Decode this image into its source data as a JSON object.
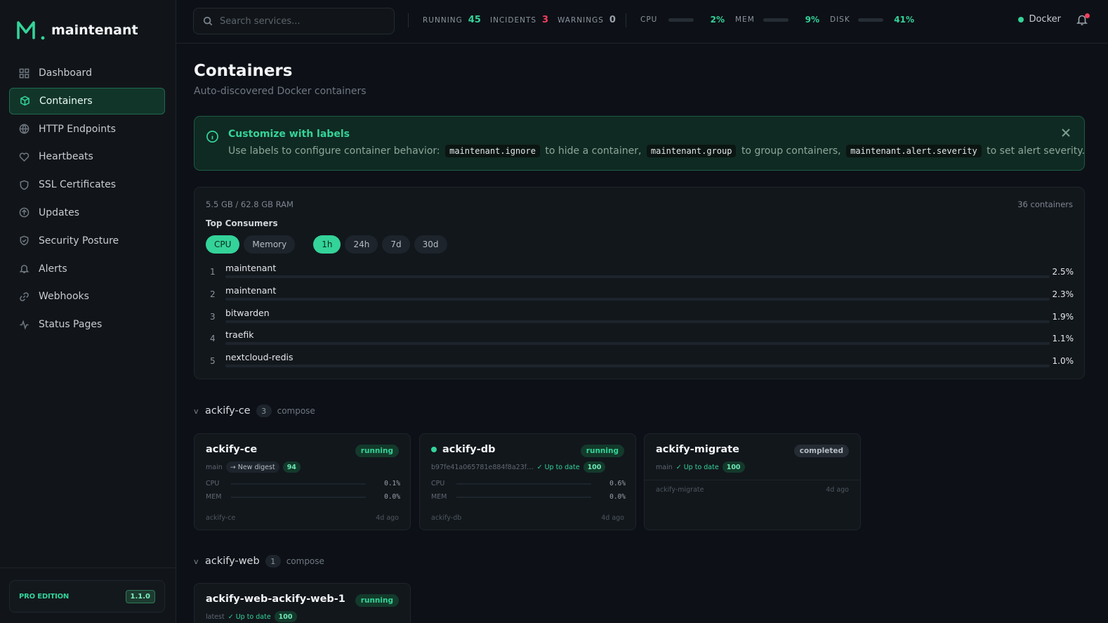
{
  "app": {
    "name": "maintenant"
  },
  "sidebar": {
    "items": [
      {
        "label": "Dashboard",
        "icon": "dashboard-icon"
      },
      {
        "label": "Containers",
        "icon": "box-icon"
      },
      {
        "label": "HTTP Endpoints",
        "icon": "globe-icon"
      },
      {
        "label": "Heartbeats",
        "icon": "heart-icon"
      },
      {
        "label": "SSL Certificates",
        "icon": "shield-icon"
      },
      {
        "label": "Updates",
        "icon": "arrow-up-circle-icon"
      },
      {
        "label": "Security Posture",
        "icon": "shield-check-icon"
      },
      {
        "label": "Alerts",
        "icon": "bell-icon"
      },
      {
        "label": "Webhooks",
        "icon": "link-icon"
      },
      {
        "label": "Status Pages",
        "icon": "activity-icon"
      }
    ],
    "active_index": 1,
    "edition": {
      "label": "PRO EDITION",
      "version": "1.1.0"
    }
  },
  "topbar": {
    "search_placeholder": "Search services...",
    "running": {
      "label": "RUNNING",
      "value": "45"
    },
    "incidents": {
      "label": "INCIDENTS",
      "value": "3"
    },
    "warnings": {
      "label": "WARNINGS",
      "value": "0"
    },
    "cpu": {
      "label": "CPU",
      "value": "2%",
      "fraction": 0.02
    },
    "mem": {
      "label": "MEM",
      "value": "9%",
      "fraction": 0.09
    },
    "disk": {
      "label": "DISK",
      "value": "41%",
      "fraction": 0.41
    },
    "runtime": "Docker"
  },
  "page": {
    "title": "Containers",
    "subtitle": "Auto-discovered Docker containers"
  },
  "banner": {
    "title": "Customize with labels",
    "text1": "Use labels to configure container behavior:",
    "code1": "maintenant.ignore",
    "text2": "to hide a container,",
    "code2": "maintenant.group",
    "text3": "to group containers,",
    "code3": "maintenant.alert.severity",
    "text4": "to set alert severity."
  },
  "consumers": {
    "ram": "5.5 GB / 62.8 GB RAM",
    "count": "36 containers",
    "title": "Top Consumers",
    "metric_tabs": [
      "CPU",
      "Memory"
    ],
    "range_tabs": [
      "1h",
      "24h",
      "7d",
      "30d"
    ],
    "active_metric": "CPU",
    "active_range": "1h",
    "rows": [
      {
        "rank": "1",
        "name": "maintenant",
        "pct": "2.5%",
        "value": 2.5
      },
      {
        "rank": "2",
        "name": "maintenant",
        "pct": "2.3%",
        "value": 2.3
      },
      {
        "rank": "3",
        "name": "bitwarden",
        "pct": "1.9%",
        "value": 1.9
      },
      {
        "rank": "4",
        "name": "traefik",
        "pct": "1.1%",
        "value": 1.1
      },
      {
        "rank": "5",
        "name": "nextcloud-redis",
        "pct": "1.0%",
        "value": 1.0
      }
    ]
  },
  "groups": [
    {
      "name": "ackify-ce",
      "count": "3",
      "type": "compose",
      "cards": [
        {
          "name": "ackify-ce",
          "status": "running",
          "tag": "main",
          "update": "New digest",
          "score": "94",
          "cpu_label": "CPU",
          "cpu": "0.1%",
          "mem_label": "MEM",
          "mem": "0.0%",
          "service": "ackify-ce",
          "ago": "4d ago"
        },
        {
          "name": "ackify-db",
          "status": "running",
          "tag": "b97fe41a065781e884f8a23f…",
          "update": "Up to date",
          "score": "100",
          "cpu_label": "CPU",
          "cpu": "0.6%",
          "mem_label": "MEM",
          "mem": "0.0%",
          "service": "ackify-db",
          "ago": "4d ago"
        },
        {
          "name": "ackify-migrate",
          "status": "completed",
          "tag": "main",
          "update": "Up to date",
          "score": "100",
          "service": "ackify-migrate",
          "ago": "4d ago"
        }
      ]
    },
    {
      "name": "ackify-web",
      "count": "1",
      "type": "compose",
      "cards": [
        {
          "name": "ackify-web-ackify-web-1",
          "status": "running",
          "tag": "latest",
          "update": "Up to date",
          "score": "100"
        }
      ]
    }
  ],
  "colors": {
    "accent": "#34d399",
    "danger": "#f43f5e",
    "background": "#0d1117"
  }
}
